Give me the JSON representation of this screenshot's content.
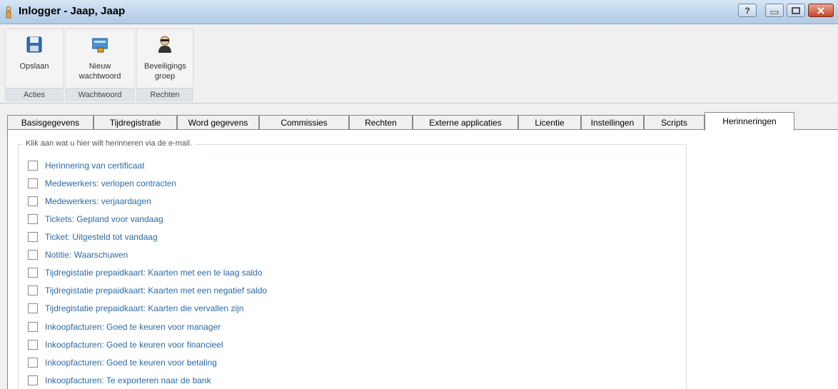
{
  "window": {
    "title": "Inlogger - Jaap, Jaap",
    "buttons": {
      "help": "?",
      "minimize": "minimize-icon",
      "maximize": "maximize-icon",
      "close": "close-icon"
    }
  },
  "ribbon": {
    "groups": [
      {
        "button_label": "Opslaan",
        "group_label": "Acties",
        "icon": "save-icon"
      },
      {
        "button_label": "Nieuw wachtwoord",
        "group_label": "Wachtwoord",
        "icon": "password-card-icon"
      },
      {
        "button_label": "Beveiligings groep",
        "group_label": "Rechten",
        "icon": "security-person-icon"
      }
    ]
  },
  "tabs": [
    "Basisgegevens",
    "Tijdregistratie",
    "Word gegevens",
    "Commissies",
    "Rechten",
    "Externe applicaties",
    "Licentie",
    "Instellingen",
    "Scripts",
    "Herinneringen"
  ],
  "active_tab": "Herinneringen",
  "reminders": {
    "legend": "Klik aan wat u hier wilt herinneren via de e-mail.",
    "items": [
      "Herinnering van certificaat",
      "Medewerkers: verlopen contracten",
      "Medewerkers: verjaardagen",
      "Tickets: Gepland voor vandaag",
      "Ticket: Uitgesteld tot vandaag",
      "Notitie: Waarschuwen",
      "Tijdregistatie prepaidkaart: Kaarten met een te laag saldo",
      "Tijdregistatie prepaidkaart: Kaarten met een negatief saldo",
      "Tijdregistatie prepaidkaart: Kaarten die vervallen zijn",
      "Inkoopfacturen: Goed te keuren voor manager",
      "Inkoopfacturen: Goed te keuren voor financieel",
      "Inkoopfacturen: Goed te keuren voor betaling",
      "Inkoopfacturen: Te exporteren naar de bank"
    ],
    "checked": [
      false,
      false,
      false,
      false,
      false,
      false,
      false,
      false,
      false,
      false,
      false,
      false,
      false
    ]
  }
}
